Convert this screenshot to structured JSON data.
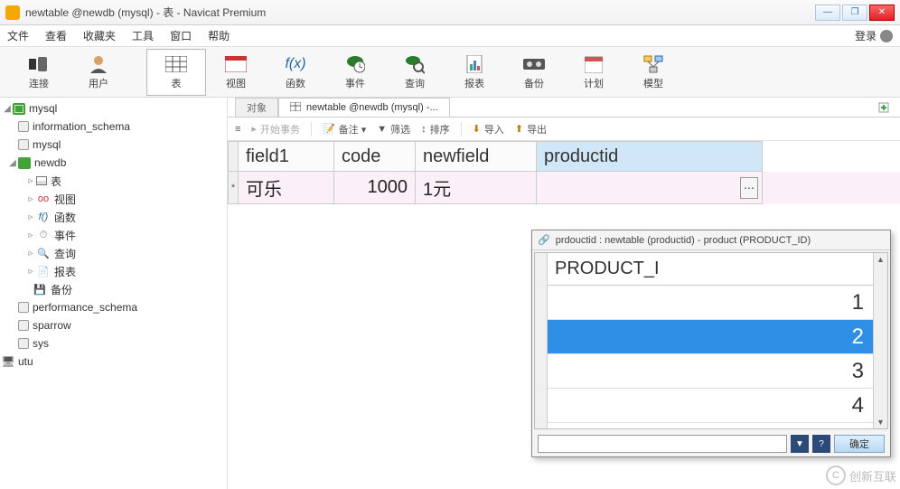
{
  "title": "newtable @newdb (mysql) - 表 - Navicat Premium",
  "menu": [
    "文件",
    "查看",
    "收藏夹",
    "工具",
    "窗口",
    "帮助"
  ],
  "login_label": "登录",
  "toolbar": [
    {
      "label": "连接",
      "icon": "plug-icon"
    },
    {
      "label": "用户",
      "icon": "user-icon"
    },
    {
      "label": "表",
      "icon": "table-icon",
      "active": true
    },
    {
      "label": "视图",
      "icon": "view-icon"
    },
    {
      "label": "函数",
      "icon": "fx-icon"
    },
    {
      "label": "事件",
      "icon": "event-icon"
    },
    {
      "label": "查询",
      "icon": "query-icon"
    },
    {
      "label": "报表",
      "icon": "report-icon"
    },
    {
      "label": "备份",
      "icon": "backup-icon"
    },
    {
      "label": "计划",
      "icon": "schedule-icon"
    },
    {
      "label": "模型",
      "icon": "model-icon"
    }
  ],
  "tree": {
    "root": "mysql",
    "children": [
      {
        "label": "information_schema",
        "type": "schema"
      },
      {
        "label": "mysql",
        "type": "schema"
      },
      {
        "label": "newdb",
        "type": "newdb",
        "expanded": true,
        "children": [
          {
            "label": "表",
            "type": "table"
          },
          {
            "label": "视图",
            "type": "view"
          },
          {
            "label": "函数",
            "type": "func"
          },
          {
            "label": "事件",
            "type": "event"
          },
          {
            "label": "查询",
            "type": "query"
          },
          {
            "label": "报表",
            "type": "report"
          },
          {
            "label": "备份",
            "type": "backup"
          }
        ]
      },
      {
        "label": "performance_schema",
        "type": "schema"
      },
      {
        "label": "sparrow",
        "type": "schema"
      },
      {
        "label": "sys",
        "type": "schema"
      }
    ],
    "other": "utu"
  },
  "tabs": {
    "obj": "对象",
    "active": "newtable @newdb (mysql) -..."
  },
  "subtoolbar": {
    "begin": "开始事务",
    "note": "备注 ▾",
    "filter": "筛选",
    "sort": "排序",
    "import": "导入",
    "export": "导出"
  },
  "grid": {
    "columns": [
      "field1",
      "code",
      "newfield",
      "productid"
    ],
    "widths": [
      106,
      90,
      134,
      238
    ],
    "rows": [
      {
        "field1": "可乐",
        "code": "1000",
        "newfield": "1元",
        "productid": ""
      }
    ]
  },
  "fk": {
    "title": "prdouctid  : newtable (productid) - product (PRODUCT_ID)",
    "column": "PRODUCT_I",
    "values": [
      "1",
      "2",
      "3",
      "4"
    ],
    "selected": "2",
    "ok": "确定"
  },
  "watermark": "创新互联"
}
